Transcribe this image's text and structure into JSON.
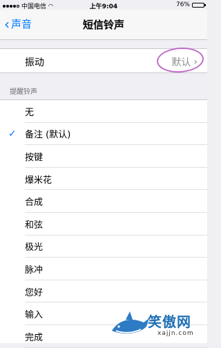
{
  "status_bar": {
    "carrier": "中国电信",
    "time": "上午9:04",
    "battery": "76%",
    "battery_level": 0.76
  },
  "nav": {
    "back_label": "声音",
    "title": "短信铃声"
  },
  "vibration": {
    "label": "振动",
    "value": "默认"
  },
  "section_header": "提醒铃声",
  "tones": [
    {
      "label": "无",
      "checked": false
    },
    {
      "label": "备注 (默认)",
      "checked": true
    },
    {
      "label": "按键",
      "checked": false
    },
    {
      "label": "爆米花",
      "checked": false
    },
    {
      "label": "合成",
      "checked": false
    },
    {
      "label": "和弦",
      "checked": false
    },
    {
      "label": "极光",
      "checked": false
    },
    {
      "label": "脉冲",
      "checked": false
    },
    {
      "label": "您好",
      "checked": false
    },
    {
      "label": "输入",
      "checked": false
    },
    {
      "label": "完成",
      "checked": false
    }
  ],
  "watermark": {
    "text": "笑傲网",
    "url": "xajjn.com"
  },
  "colors": {
    "accent": "#007aff",
    "annotation": "#c06cc9"
  }
}
